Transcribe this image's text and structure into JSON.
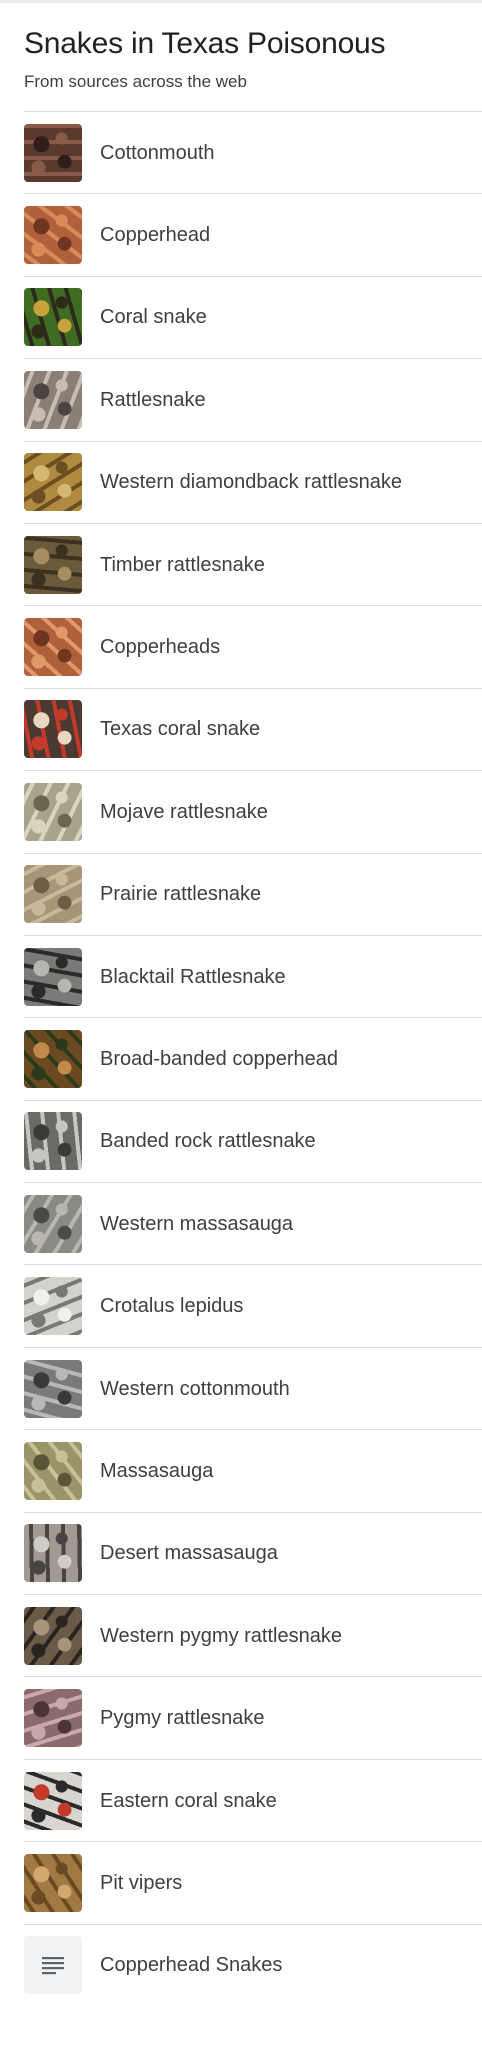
{
  "header": {
    "title": "Snakes in Texas Poisonous",
    "subtitle": "From sources across the web"
  },
  "items": [
    {
      "label": "Cottonmouth",
      "icon": "snake-thumbnail",
      "colors": [
        "#5a3a2c",
        "#8a5a48",
        "#2e1d18"
      ]
    },
    {
      "label": "Copperhead",
      "icon": "snake-thumbnail",
      "colors": [
        "#b0603b",
        "#d98c5a",
        "#6e3520"
      ]
    },
    {
      "label": "Coral snake",
      "icon": "snake-thumbnail",
      "colors": [
        "#3f6b22",
        "#2c2a1a",
        "#c8a23a"
      ]
    },
    {
      "label": "Rattlesnake",
      "icon": "snake-thumbnail",
      "colors": [
        "#8a7f77",
        "#c9bdb0",
        "#4c4440"
      ]
    },
    {
      "label": "Western diamondback rattlesnake",
      "icon": "snake-thumbnail",
      "colors": [
        "#b08a3e",
        "#6b4f22",
        "#d6b870"
      ]
    },
    {
      "label": "Timber rattlesnake",
      "icon": "snake-thumbnail",
      "colors": [
        "#6b5a3a",
        "#3a301f",
        "#a58e62"
      ]
    },
    {
      "label": "Copperheads",
      "icon": "snake-thumbnail",
      "colors": [
        "#b0603b",
        "#e09a6a",
        "#6e3520"
      ]
    },
    {
      "label": "Texas coral snake",
      "icon": "snake-thumbnail",
      "colors": [
        "#4a3a32",
        "#c43a2a",
        "#e8d8c0"
      ]
    },
    {
      "label": "Mojave rattlesnake",
      "icon": "snake-thumbnail",
      "colors": [
        "#a8a48c",
        "#d8d4c0",
        "#6a6650"
      ]
    },
    {
      "label": "Prairie rattlesnake",
      "icon": "snake-thumbnail",
      "colors": [
        "#a89478",
        "#c9b89a",
        "#6e5e48"
      ]
    },
    {
      "label": "Blacktail Rattlesnake",
      "icon": "snake-thumbnail",
      "colors": [
        "#7a7a78",
        "#2a2a28",
        "#b8b6b0"
      ]
    },
    {
      "label": "Broad-banded copperhead",
      "icon": "snake-thumbnail",
      "colors": [
        "#6b4a22",
        "#2a3a1a",
        "#c08a4a"
      ]
    },
    {
      "label": "Banded rock rattlesnake",
      "icon": "snake-thumbnail",
      "colors": [
        "#6a6a66",
        "#c8c6c0",
        "#3a3a38"
      ]
    },
    {
      "label": "Western massasauga",
      "icon": "snake-thumbnail",
      "colors": [
        "#8a8a84",
        "#b8b6ae",
        "#4a4a46"
      ]
    },
    {
      "label": "Crotalus lepidus",
      "icon": "snake-thumbnail",
      "colors": [
        "#d4d2cc",
        "#7a7872",
        "#f2f0ea"
      ]
    },
    {
      "label": "Western cottonmouth",
      "icon": "snake-thumbnail",
      "colors": [
        "#7a7a7a",
        "#b8b8b8",
        "#3a3a3a"
      ]
    },
    {
      "label": "Massasauga",
      "icon": "snake-thumbnail",
      "colors": [
        "#9a9468",
        "#c8c098",
        "#5a5438"
      ]
    },
    {
      "label": "Desert massasauga",
      "icon": "snake-thumbnail",
      "colors": [
        "#a09a90",
        "#4a4440",
        "#d0ccc4"
      ]
    },
    {
      "label": "Western pygmy rattlesnake",
      "icon": "snake-thumbnail",
      "colors": [
        "#6a5a48",
        "#2a2420",
        "#a89478"
      ]
    },
    {
      "label": "Pygmy rattlesnake",
      "icon": "snake-thumbnail",
      "colors": [
        "#8a6a6a",
        "#c8a8a8",
        "#4a3434"
      ]
    },
    {
      "label": "Eastern coral snake",
      "icon": "snake-thumbnail",
      "colors": [
        "#d8d4d0",
        "#2a2a2a",
        "#c43a2a"
      ]
    },
    {
      "label": "Pit vipers",
      "icon": "snake-thumbnail",
      "colors": [
        "#a07a42",
        "#6a4a22",
        "#d0a870"
      ]
    },
    {
      "label": "Copperhead Snakes",
      "icon": "document-icon",
      "colors": [
        "#f1f3f4",
        "#5f6368",
        "#5f6368"
      ]
    }
  ]
}
